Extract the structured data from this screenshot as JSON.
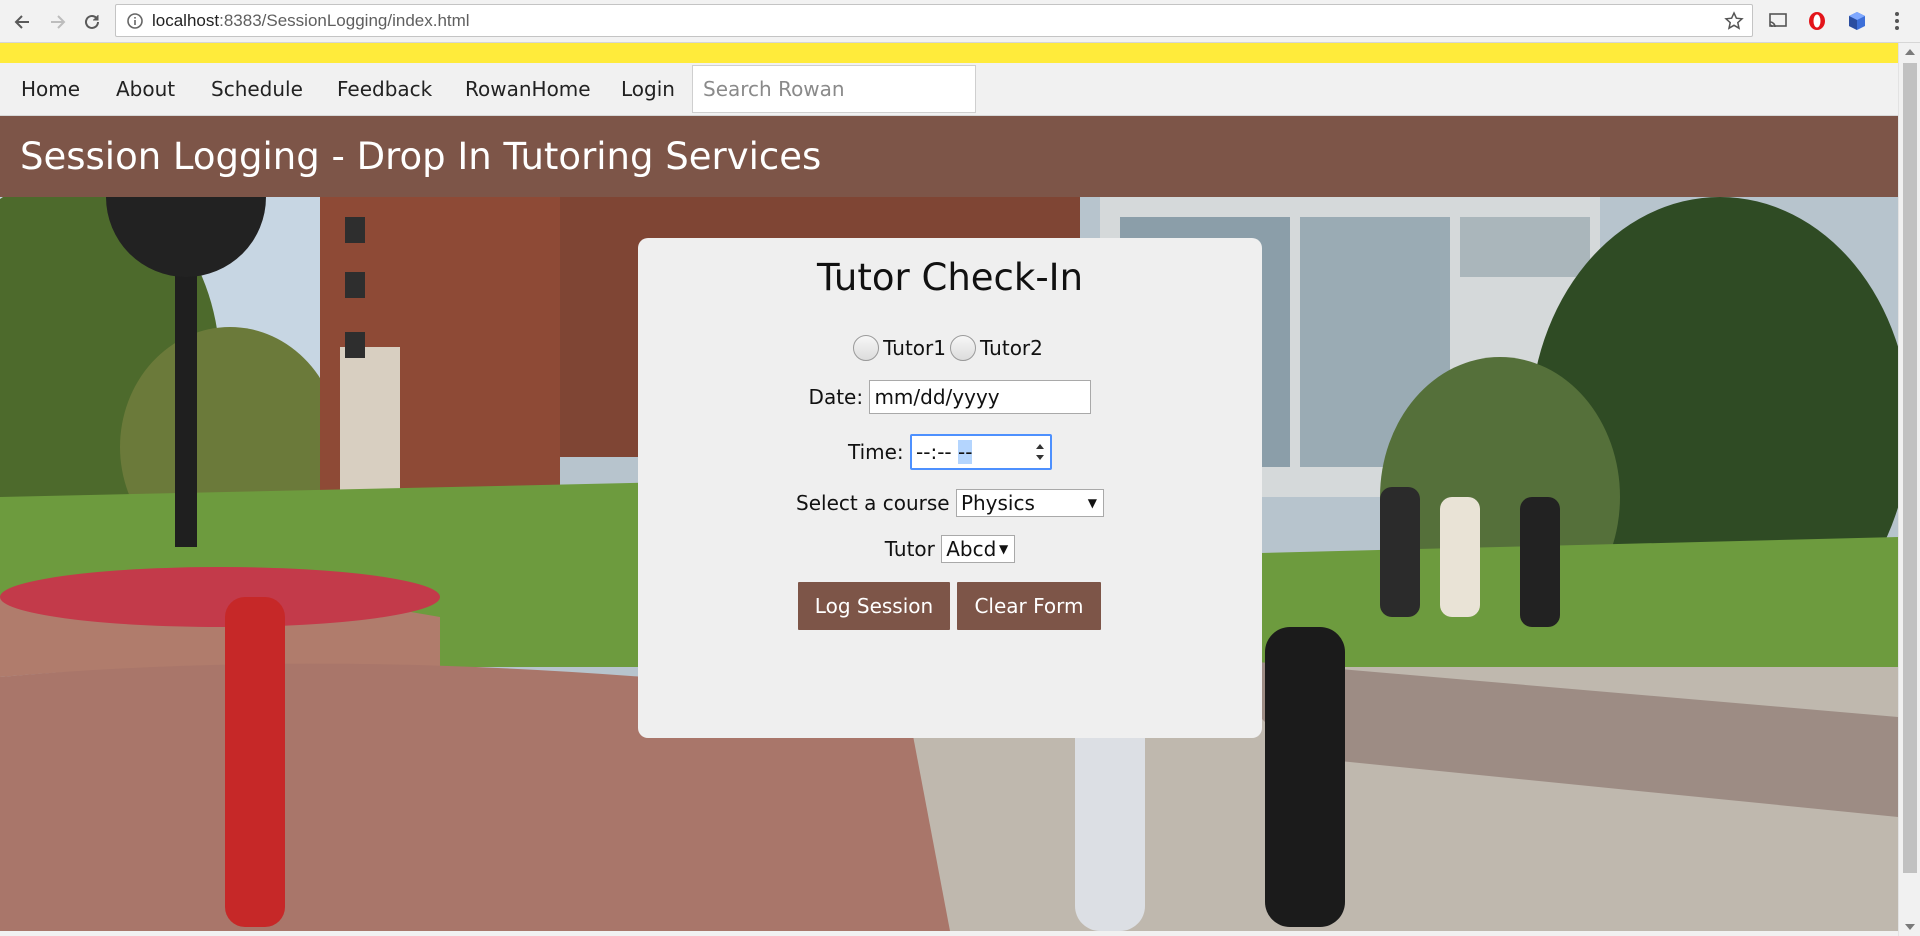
{
  "browser": {
    "url_host": "localhost",
    "url_rest": ":8383/SessionLogging/index.html"
  },
  "nav": {
    "links": [
      "Home",
      "About",
      "Schedule",
      "Feedback",
      "RowanHome",
      "Login"
    ],
    "search_placeholder": "Search Rowan"
  },
  "banner": {
    "title": "Session Logging - Drop In Tutoring Services"
  },
  "form": {
    "heading": "Tutor Check-In",
    "radio_options": [
      "Tutor1",
      "Tutor2"
    ],
    "date_label": "Date:",
    "date_placeholder": "mm/dd/yyyy",
    "time_label": "Time:",
    "time_value_main": "--:--",
    "time_value_ampm": "--",
    "course_label": "Select a course",
    "course_selected": "Physics",
    "tutor_label": "Tutor",
    "tutor_selected": "Abcd",
    "log_button": "Log Session",
    "clear_button": "Clear Form"
  },
  "colors": {
    "accent_brown": "#7d5548",
    "alert_yellow": "#ffeb3b",
    "card_bg": "#efefef"
  }
}
